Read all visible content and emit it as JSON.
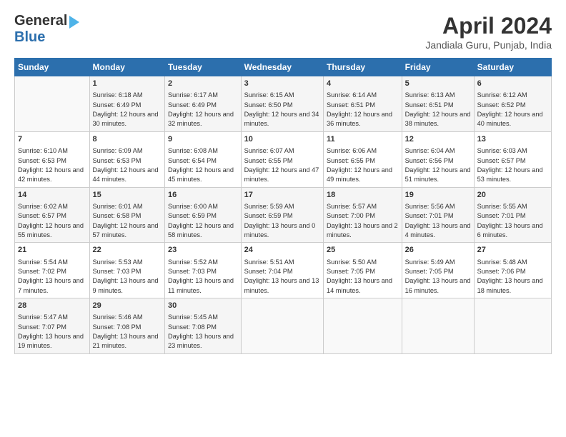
{
  "logo": {
    "line1": "General",
    "line2": "Blue"
  },
  "title": "April 2024",
  "location": "Jandiala Guru, Punjab, India",
  "days_header": [
    "Sunday",
    "Monday",
    "Tuesday",
    "Wednesday",
    "Thursday",
    "Friday",
    "Saturday"
  ],
  "weeks": [
    [
      {
        "num": "",
        "sunrise": "",
        "sunset": "",
        "daylight": ""
      },
      {
        "num": "1",
        "sunrise": "Sunrise: 6:18 AM",
        "sunset": "Sunset: 6:49 PM",
        "daylight": "Daylight: 12 hours and 30 minutes."
      },
      {
        "num": "2",
        "sunrise": "Sunrise: 6:17 AM",
        "sunset": "Sunset: 6:49 PM",
        "daylight": "Daylight: 12 hours and 32 minutes."
      },
      {
        "num": "3",
        "sunrise": "Sunrise: 6:15 AM",
        "sunset": "Sunset: 6:50 PM",
        "daylight": "Daylight: 12 hours and 34 minutes."
      },
      {
        "num": "4",
        "sunrise": "Sunrise: 6:14 AM",
        "sunset": "Sunset: 6:51 PM",
        "daylight": "Daylight: 12 hours and 36 minutes."
      },
      {
        "num": "5",
        "sunrise": "Sunrise: 6:13 AM",
        "sunset": "Sunset: 6:51 PM",
        "daylight": "Daylight: 12 hours and 38 minutes."
      },
      {
        "num": "6",
        "sunrise": "Sunrise: 6:12 AM",
        "sunset": "Sunset: 6:52 PM",
        "daylight": "Daylight: 12 hours and 40 minutes."
      }
    ],
    [
      {
        "num": "7",
        "sunrise": "Sunrise: 6:10 AM",
        "sunset": "Sunset: 6:53 PM",
        "daylight": "Daylight: 12 hours and 42 minutes."
      },
      {
        "num": "8",
        "sunrise": "Sunrise: 6:09 AM",
        "sunset": "Sunset: 6:53 PM",
        "daylight": "Daylight: 12 hours and 44 minutes."
      },
      {
        "num": "9",
        "sunrise": "Sunrise: 6:08 AM",
        "sunset": "Sunset: 6:54 PM",
        "daylight": "Daylight: 12 hours and 45 minutes."
      },
      {
        "num": "10",
        "sunrise": "Sunrise: 6:07 AM",
        "sunset": "Sunset: 6:55 PM",
        "daylight": "Daylight: 12 hours and 47 minutes."
      },
      {
        "num": "11",
        "sunrise": "Sunrise: 6:06 AM",
        "sunset": "Sunset: 6:55 PM",
        "daylight": "Daylight: 12 hours and 49 minutes."
      },
      {
        "num": "12",
        "sunrise": "Sunrise: 6:04 AM",
        "sunset": "Sunset: 6:56 PM",
        "daylight": "Daylight: 12 hours and 51 minutes."
      },
      {
        "num": "13",
        "sunrise": "Sunrise: 6:03 AM",
        "sunset": "Sunset: 6:57 PM",
        "daylight": "Daylight: 12 hours and 53 minutes."
      }
    ],
    [
      {
        "num": "14",
        "sunrise": "Sunrise: 6:02 AM",
        "sunset": "Sunset: 6:57 PM",
        "daylight": "Daylight: 12 hours and 55 minutes."
      },
      {
        "num": "15",
        "sunrise": "Sunrise: 6:01 AM",
        "sunset": "Sunset: 6:58 PM",
        "daylight": "Daylight: 12 hours and 57 minutes."
      },
      {
        "num": "16",
        "sunrise": "Sunrise: 6:00 AM",
        "sunset": "Sunset: 6:59 PM",
        "daylight": "Daylight: 12 hours and 58 minutes."
      },
      {
        "num": "17",
        "sunrise": "Sunrise: 5:59 AM",
        "sunset": "Sunset: 6:59 PM",
        "daylight": "Daylight: 13 hours and 0 minutes."
      },
      {
        "num": "18",
        "sunrise": "Sunrise: 5:57 AM",
        "sunset": "Sunset: 7:00 PM",
        "daylight": "Daylight: 13 hours and 2 minutes."
      },
      {
        "num": "19",
        "sunrise": "Sunrise: 5:56 AM",
        "sunset": "Sunset: 7:01 PM",
        "daylight": "Daylight: 13 hours and 4 minutes."
      },
      {
        "num": "20",
        "sunrise": "Sunrise: 5:55 AM",
        "sunset": "Sunset: 7:01 PM",
        "daylight": "Daylight: 13 hours and 6 minutes."
      }
    ],
    [
      {
        "num": "21",
        "sunrise": "Sunrise: 5:54 AM",
        "sunset": "Sunset: 7:02 PM",
        "daylight": "Daylight: 13 hours and 7 minutes."
      },
      {
        "num": "22",
        "sunrise": "Sunrise: 5:53 AM",
        "sunset": "Sunset: 7:03 PM",
        "daylight": "Daylight: 13 hours and 9 minutes."
      },
      {
        "num": "23",
        "sunrise": "Sunrise: 5:52 AM",
        "sunset": "Sunset: 7:03 PM",
        "daylight": "Daylight: 13 hours and 11 minutes."
      },
      {
        "num": "24",
        "sunrise": "Sunrise: 5:51 AM",
        "sunset": "Sunset: 7:04 PM",
        "daylight": "Daylight: 13 hours and 13 minutes."
      },
      {
        "num": "25",
        "sunrise": "Sunrise: 5:50 AM",
        "sunset": "Sunset: 7:05 PM",
        "daylight": "Daylight: 13 hours and 14 minutes."
      },
      {
        "num": "26",
        "sunrise": "Sunrise: 5:49 AM",
        "sunset": "Sunset: 7:05 PM",
        "daylight": "Daylight: 13 hours and 16 minutes."
      },
      {
        "num": "27",
        "sunrise": "Sunrise: 5:48 AM",
        "sunset": "Sunset: 7:06 PM",
        "daylight": "Daylight: 13 hours and 18 minutes."
      }
    ],
    [
      {
        "num": "28",
        "sunrise": "Sunrise: 5:47 AM",
        "sunset": "Sunset: 7:07 PM",
        "daylight": "Daylight: 13 hours and 19 minutes."
      },
      {
        "num": "29",
        "sunrise": "Sunrise: 5:46 AM",
        "sunset": "Sunset: 7:08 PM",
        "daylight": "Daylight: 13 hours and 21 minutes."
      },
      {
        "num": "30",
        "sunrise": "Sunrise: 5:45 AM",
        "sunset": "Sunset: 7:08 PM",
        "daylight": "Daylight: 13 hours and 23 minutes."
      },
      {
        "num": "",
        "sunrise": "",
        "sunset": "",
        "daylight": ""
      },
      {
        "num": "",
        "sunrise": "",
        "sunset": "",
        "daylight": ""
      },
      {
        "num": "",
        "sunrise": "",
        "sunset": "",
        "daylight": ""
      },
      {
        "num": "",
        "sunrise": "",
        "sunset": "",
        "daylight": ""
      }
    ]
  ]
}
